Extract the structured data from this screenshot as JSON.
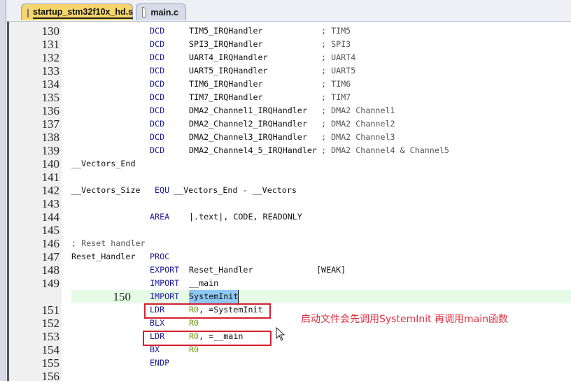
{
  "tabs": [
    {
      "label": "startup_stm32f10x_hd.s",
      "active": true
    },
    {
      "label": "main.c",
      "active": false
    }
  ],
  "lines": [
    {
      "n": "130",
      "label": "",
      "op": "DCD",
      "arg": "TIM5_IRQHandler",
      "comment": "; TIM5"
    },
    {
      "n": "131",
      "label": "",
      "op": "DCD",
      "arg": "SPI3_IRQHandler",
      "comment": "; SPI3"
    },
    {
      "n": "132",
      "label": "",
      "op": "DCD",
      "arg": "UART4_IRQHandler",
      "comment": "; UART4"
    },
    {
      "n": "133",
      "label": "",
      "op": "DCD",
      "arg": "UART5_IRQHandler",
      "comment": "; UART5"
    },
    {
      "n": "134",
      "label": "",
      "op": "DCD",
      "arg": "TIM6_IRQHandler",
      "comment": "; TIM6"
    },
    {
      "n": "135",
      "label": "",
      "op": "DCD",
      "arg": "TIM7_IRQHandler",
      "comment": "; TIM7"
    },
    {
      "n": "136",
      "label": "",
      "op": "DCD",
      "arg": "DMA2_Channel1_IRQHandler",
      "comment": "; DMA2 Channel1"
    },
    {
      "n": "137",
      "label": "",
      "op": "DCD",
      "arg": "DMA2_Channel2_IRQHandler",
      "comment": "; DMA2 Channel2"
    },
    {
      "n": "138",
      "label": "",
      "op": "DCD",
      "arg": "DMA2_Channel3_IRQHandler",
      "comment": "; DMA2 Channel3"
    },
    {
      "n": "139",
      "label": "",
      "op": "DCD",
      "arg": "DMA2_Channel4_5_IRQHandler",
      "comment": "; DMA2 Channel4 & Channel5"
    },
    {
      "n": "140",
      "label": "__Vectors_End",
      "op": "",
      "arg": "",
      "comment": ""
    },
    {
      "n": "141",
      "label": "",
      "op": "",
      "arg": "",
      "comment": ""
    },
    {
      "n": "142",
      "label": "__Vectors_Size",
      "op": "EQU",
      "arg": "__Vectors_End - __Vectors",
      "comment": "",
      "argAt": "op1"
    },
    {
      "n": "143",
      "label": "",
      "op": "",
      "arg": "",
      "comment": ""
    },
    {
      "n": "144",
      "label": "",
      "op": "AREA",
      "arg": "|.text|, CODE, READONLY",
      "comment": ""
    },
    {
      "n": "145",
      "label": "",
      "op": "",
      "arg": "",
      "comment": ""
    },
    {
      "n": "146",
      "label": "",
      "op": "",
      "arg": "",
      "comment": "; Reset handler",
      "commentAt": "label"
    },
    {
      "n": "147",
      "label": "Reset_Handler",
      "op": "PROC",
      "arg": "",
      "comment": ""
    },
    {
      "n": "148",
      "label": "",
      "op": "EXPORT",
      "arg": "Reset_Handler",
      "comment": "[WEAK]",
      "commentAt": "weak"
    },
    {
      "n": "149",
      "label": "",
      "op": "IMPORT",
      "arg": "__main",
      "comment": ""
    },
    {
      "n": "150",
      "label": "",
      "op": "IMPORT",
      "arg": "SystemInit",
      "comment": "",
      "highlight": true,
      "selected": true
    },
    {
      "n": "151",
      "label": "",
      "op": "LDR",
      "arg": "R0, =SystemInit",
      "comment": ""
    },
    {
      "n": "152",
      "label": "",
      "op": "BLX",
      "arg": "R0",
      "comment": ""
    },
    {
      "n": "153",
      "label": "",
      "op": "LDR",
      "arg": "R0, =__main",
      "comment": ""
    },
    {
      "n": "154",
      "label": "",
      "op": "BX",
      "arg": "R0",
      "comment": ""
    },
    {
      "n": "155",
      "label": "",
      "op": "ENDP",
      "arg": "",
      "comment": ""
    },
    {
      "n": "156",
      "label": "",
      "op": "",
      "arg": "",
      "comment": ""
    }
  ],
  "annotation": "启动文件会先调用SystemInit  再调用main函数",
  "colors": {
    "keyword": "#1a1a9a",
    "register": "#6b9a10",
    "annotation": "#e03040",
    "box": "#d42030",
    "highlight": "#e6fbe6",
    "selection": "#8ec8f4"
  }
}
